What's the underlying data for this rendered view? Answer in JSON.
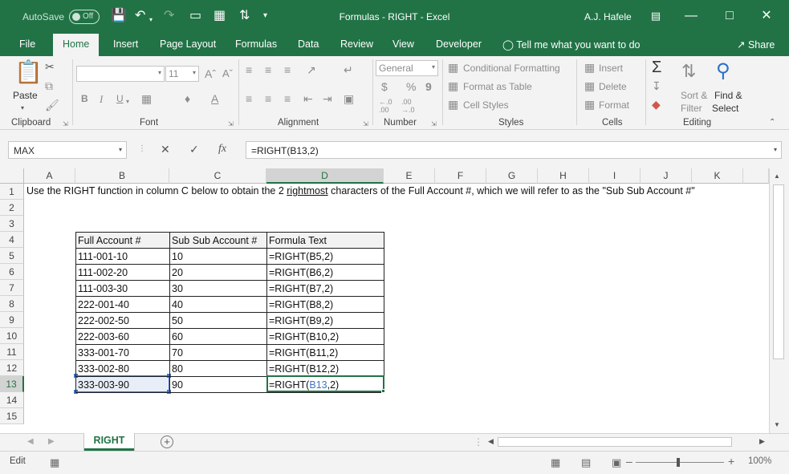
{
  "titlebar": {
    "autosave": "AutoSave",
    "autosave_state": "Off",
    "title": "Formulas - RIGHT  -  Excel",
    "user": "A.J. Hafele"
  },
  "tabs": [
    "File",
    "Home",
    "Insert",
    "Page Layout",
    "Formulas",
    "Data",
    "Review",
    "Developer"
  ],
  "tell_me": "Tell me what you want to do",
  "share": "Share",
  "ribbon": {
    "clipboard": {
      "label": "Clipboard",
      "paste": "Paste"
    },
    "font": {
      "label": "Font",
      "size": "11",
      "bold": "B",
      "italic": "I",
      "underline": "U"
    },
    "alignment": {
      "label": "Alignment"
    },
    "number": {
      "label": "Number",
      "format": "General",
      "currency": "$",
      "percent": "%",
      "comma": "9"
    },
    "styles": {
      "label": "Styles",
      "conditional": "Conditional Formatting",
      "table": "Format as Table",
      "cell": "Cell Styles"
    },
    "cells": {
      "label": "Cells",
      "insert": "Insert",
      "delete": "Delete",
      "format": "Format"
    },
    "editing": {
      "label": "Editing",
      "sort": "Sort &",
      "filter": "Filter",
      "find": "Find &",
      "select": "Select"
    }
  },
  "formula_bar": {
    "name_box": "MAX",
    "formula": "=RIGHT(B13,2)"
  },
  "grid": {
    "columns": [
      "A",
      "B",
      "C",
      "D",
      "E",
      "F",
      "G",
      "H",
      "I",
      "J",
      "K"
    ],
    "rows": [
      "1",
      "2",
      "3",
      "4",
      "5",
      "6",
      "7",
      "8",
      "9",
      "10",
      "11",
      "12",
      "13",
      "14",
      "15"
    ],
    "intro_before": "Use the RIGHT function in column C below to obtain the 2 ",
    "intro_underlined": "rightmost",
    "intro_after": " characters of the Full Account #, which we will refer to as the \"Sub Sub Account #\"",
    "table_headers": [
      "Full Account #",
      "Sub Sub Account #",
      "Formula Text"
    ],
    "table_rows": [
      [
        "111-001-10",
        "10",
        "=RIGHT(B5,2)"
      ],
      [
        "111-002-20",
        "20",
        "=RIGHT(B6,2)"
      ],
      [
        "111-003-30",
        "30",
        "=RIGHT(B7,2)"
      ],
      [
        "222-001-40",
        "40",
        "=RIGHT(B8,2)"
      ],
      [
        "222-002-50",
        "50",
        "=RIGHT(B9,2)"
      ],
      [
        "222-003-60",
        "60",
        "=RIGHT(B10,2)"
      ],
      [
        "333-001-70",
        "70",
        "=RIGHT(B11,2)"
      ],
      [
        "333-002-80",
        "80",
        "=RIGHT(B12,2)"
      ],
      [
        "333-003-90",
        "90",
        ""
      ]
    ],
    "edit_cell": {
      "before": "=RIGHT(",
      "ref": "B13",
      "after": ",2)"
    }
  },
  "sheet_tab": "RIGHT",
  "status": {
    "mode": "Edit",
    "zoom": "100%"
  },
  "colors": {
    "excel_green": "#217346",
    "ref_blue": "#4472c4"
  }
}
